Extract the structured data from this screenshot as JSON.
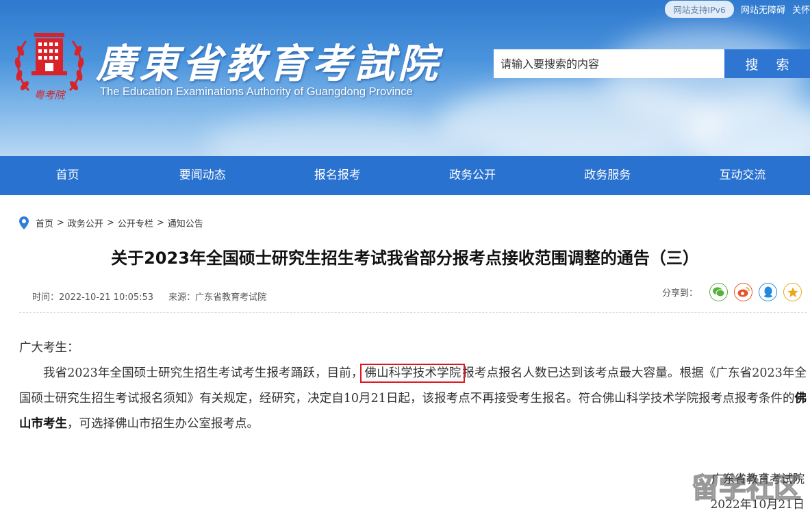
{
  "header": {
    "top_links": {
      "ipv6": "网站支持IPv6",
      "accessibility": "网站无障碍",
      "care": "关怀"
    },
    "site_name_cn": "廣東省教育考試院",
    "site_name_en": "The Education Examinations Authority of Guangdong Province",
    "logo_text": "粤考院",
    "search": {
      "placeholder": "请输入要搜索的内容",
      "button_label": "搜  索"
    },
    "colors": {
      "nav": "#2a72d0",
      "search_button": "#2f76d2"
    }
  },
  "nav": {
    "items": [
      {
        "label": "首页"
      },
      {
        "label": "要闻动态"
      },
      {
        "label": "报名报考"
      },
      {
        "label": "政务公开"
      },
      {
        "label": "政务服务"
      },
      {
        "label": "互动交流"
      }
    ]
  },
  "breadcrumb": {
    "items": [
      "首页",
      "政务公开",
      "公开专栏",
      "通知公告"
    ],
    "separator": ">"
  },
  "article": {
    "title": "关于2023年全国硕士研究生招生考试我省部分报考点接收范围调整的通告（三）",
    "time": "时间：2022-10-21 10:05:53",
    "source": "来源：广东省教育考试院",
    "share_label": "分享到：",
    "share_icons": [
      "wechat-icon",
      "weibo-icon",
      "qq-icon",
      "qzone-icon"
    ],
    "greeting": "广大考生：",
    "para1_before": "我省2023年全国硕士研究生招生考试考生报考踊跃，目前，",
    "para1_highlight": "佛山科学技术学院",
    "para1_after": "报考点报名人数已达到该考点最大容量。根据《广东省2023年全国硕士研究生招生考试报名须知》有关规定，经研究，决定自10月21日起，该报考点不再接受考生报名。符合佛山科学技术学院报考点报考条件的",
    "para1_bold": "佛山市考生",
    "para1_end": "，可选择佛山市招生办公室报考点。",
    "signature_org": "广东省教育考试院",
    "signature_date": "2022年10月21日"
  },
  "watermark": "留学社区"
}
